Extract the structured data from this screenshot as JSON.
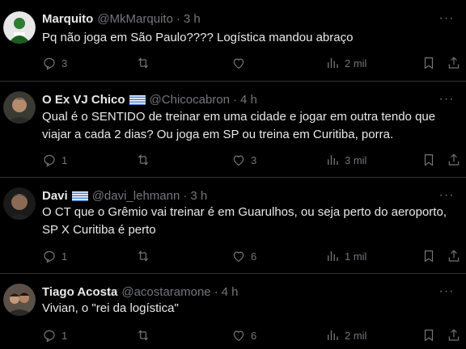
{
  "tweets": [
    {
      "name": "Marquito",
      "handle": "@MkMarquito",
      "time": "3 h",
      "text": "Pq não joga em São Paulo???? Logística mandou abraço",
      "replies": "3",
      "retweets": "",
      "likes": "",
      "views": "2 mil"
    },
    {
      "name": "O Ex VJ Chico",
      "handle": "@Chicocabron",
      "time": "4 h",
      "text": "Qual é o SENTIDO de treinar em uma cidade e jogar em outra tendo que\nviajar a cada 2 dias? Ou joga em SP ou treina em Curitiba, porra.",
      "replies": "1",
      "retweets": "",
      "likes": "3",
      "views": "3 mil"
    },
    {
      "name": "Davi",
      "handle": "@davi_lehmann",
      "time": "3 h",
      "text": "O CT que o Grêmio vai treinar é em Guarulhos, ou seja perto do aeroporto,\nSP X Curitiba é perto",
      "replies": "1",
      "retweets": "",
      "likes": "6",
      "views": "1 mil"
    },
    {
      "name": "Tiago Acosta",
      "handle": "@acostaramone",
      "time": "4 h",
      "text": "Vivian, o \"rei da logística\"",
      "replies": "1",
      "retweets": "",
      "likes": "6",
      "views": "2 mil"
    }
  ],
  "colors": {
    "background": "#000000",
    "text": "#e7e9ea",
    "muted": "#71767b",
    "divider": "#2f3336"
  },
  "icons": {
    "reply": "reply-icon",
    "retweet": "retweet-icon",
    "like": "heart-icon",
    "views": "views-chart-icon",
    "bookmark": "bookmark-icon",
    "share": "share-icon",
    "more": "more-dots-icon"
  },
  "more_label": "···"
}
